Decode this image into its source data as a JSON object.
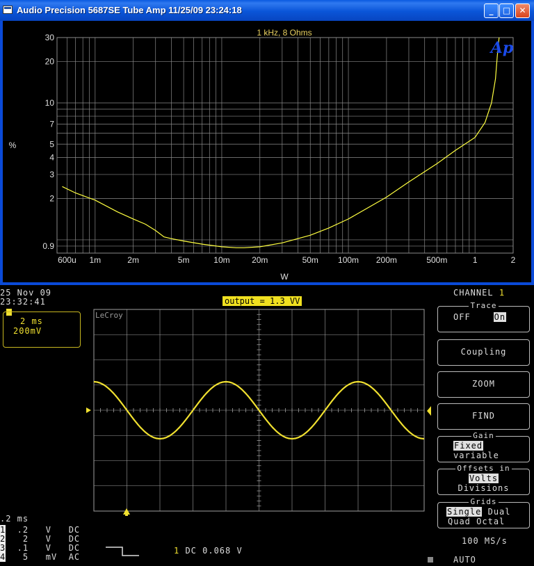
{
  "window": {
    "title": "Audio Precision  5687SE Tube Amp  11/25/09 23:24:18",
    "controls": {
      "minimize": "_",
      "maximize": "□",
      "close": "✕"
    }
  },
  "chart_data": [
    {
      "type": "line",
      "title": "1 kHz, 8 Ohms",
      "xlabel": "W",
      "ylabel": "%",
      "x_scale": "log",
      "y_scale": "log",
      "xlim": [
        0.0005,
        2
      ],
      "ylim": [
        0.8,
        30
      ],
      "x_ticks": [
        {
          "value": 0.0006,
          "label": "600u"
        },
        {
          "value": 0.001,
          "label": "1m"
        },
        {
          "value": 0.002,
          "label": "2m"
        },
        {
          "value": 0.005,
          "label": "5m"
        },
        {
          "value": 0.01,
          "label": "10m"
        },
        {
          "value": 0.02,
          "label": "20m"
        },
        {
          "value": 0.05,
          "label": "50m"
        },
        {
          "value": 0.1,
          "label": "100m"
        },
        {
          "value": 0.2,
          "label": "200m"
        },
        {
          "value": 0.5,
          "label": "500m"
        },
        {
          "value": 1,
          "label": "1"
        },
        {
          "value": 2,
          "label": "2"
        }
      ],
      "y_ticks": [
        {
          "value": 0.9,
          "label": "0.9"
        },
        {
          "value": 2,
          "label": "2"
        },
        {
          "value": 3,
          "label": "3"
        },
        {
          "value": 4,
          "label": "4"
        },
        {
          "value": 5,
          "label": "5"
        },
        {
          "value": 7,
          "label": "7"
        },
        {
          "value": 10,
          "label": "10"
        },
        {
          "value": 20,
          "label": "20"
        },
        {
          "value": 30,
          "label": "30"
        }
      ],
      "grid": true,
      "colors": {
        "background": "#000000",
        "grid": "#8a8a8a",
        "trace": "#ffff40",
        "text": "#e0e0e0",
        "title": "#e8d060"
      },
      "logo": "Ap",
      "series": [
        {
          "x": [
            0.00055,
            0.0007,
            0.001,
            0.0015,
            0.002,
            0.0025,
            0.003,
            0.0035,
            0.004,
            0.005,
            0.007,
            0.01,
            0.013,
            0.015,
            0.02,
            0.03,
            0.05,
            0.07,
            0.1,
            0.2,
            0.3,
            0.5,
            0.7,
            1,
            1.2,
            1.35,
            1.45,
            1.5,
            1.55
          ],
          "y": [
            2.45,
            2.2,
            1.95,
            1.6,
            1.42,
            1.3,
            1.17,
            1.05,
            1.02,
            0.98,
            0.93,
            0.89,
            0.875,
            0.875,
            0.89,
            0.95,
            1.08,
            1.22,
            1.42,
            2.05,
            2.65,
            3.6,
            4.5,
            5.6,
            7.2,
            10,
            15,
            22,
            30
          ]
        }
      ]
    },
    {
      "type": "line",
      "title": "",
      "grid": true,
      "xlim": [
        -5,
        5
      ],
      "ylim": [
        -4,
        4
      ],
      "waveform": {
        "amplitude_div": 1.13,
        "cycles": 2.5,
        "phase_start": "peak"
      },
      "colors": {
        "background": "#000000",
        "grid": "#a0a0a0",
        "trace": "#f0e030"
      }
    }
  ],
  "scope": {
    "date": "25 Nov 09",
    "time": "23:32:41",
    "timebase": "2 ms",
    "volts_div": "200mV",
    "output_readout": "output = 1.3 VV",
    "brand": "LeCroy",
    "cursor_time": ".2 ms",
    "channels": [
      {
        "num": "1",
        "scale": ".2",
        "unit": "V",
        "coupling": "DC"
      },
      {
        "num": "2",
        "scale": "2",
        "unit": "V",
        "coupling": "DC"
      },
      {
        "num": "3",
        "scale": ".1",
        "unit": "V",
        "coupling": "DC"
      },
      {
        "num": "4",
        "scale": "5",
        "unit": "mV",
        "coupling": "AC"
      }
    ],
    "trigger_readout": "1 DC 0.068 V",
    "trigger_channel": "1",
    "sample_rate": "100 MS/s",
    "trigger_mode": "AUTO",
    "menu": {
      "heading": "CHANNEL",
      "heading_num": "1",
      "trace": {
        "title": "Trace",
        "off": "OFF",
        "on": "On"
      },
      "coupling": "Coupling",
      "zoom": "ZOOM",
      "find": "FIND",
      "gain": {
        "title": "Gain",
        "fixed": "Fixed",
        "variable": "variable"
      },
      "offsets": {
        "title": "Offsets in",
        "volts": "Volts",
        "divisions": "Divisions"
      },
      "grids": {
        "title": "Grids",
        "single": "Single",
        "dual": "Dual",
        "quad": "Quad",
        "octal": "Octal"
      }
    }
  }
}
